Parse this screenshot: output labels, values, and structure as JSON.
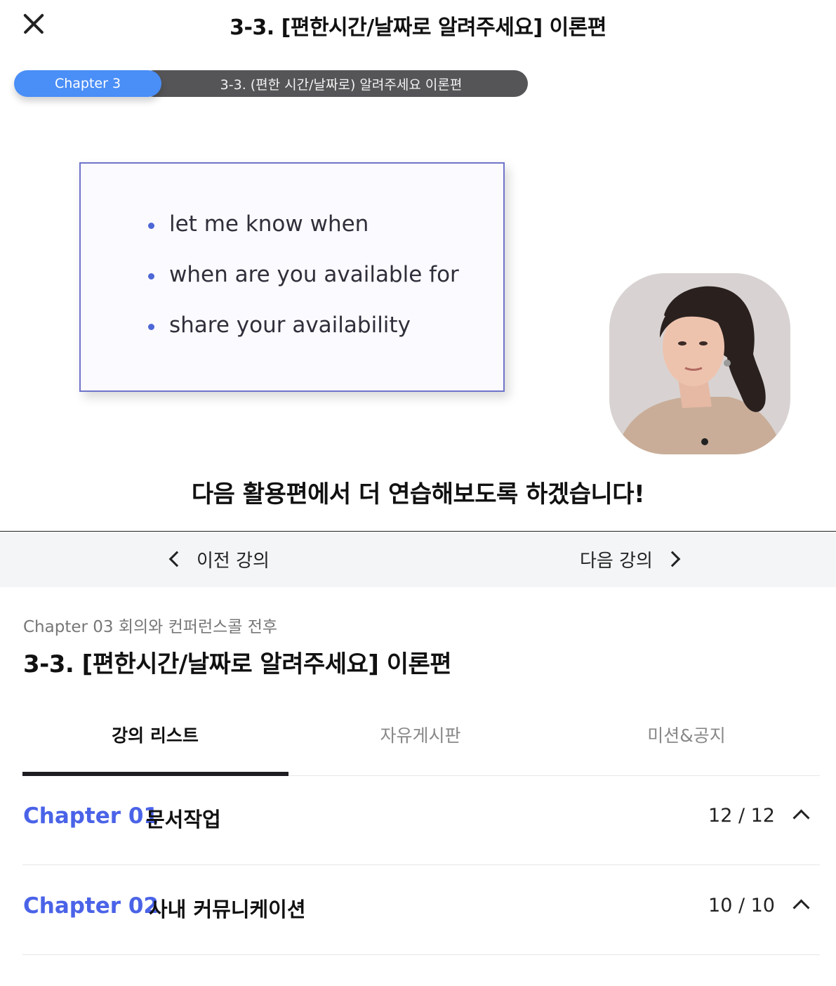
{
  "header": {
    "close_icon": "close-icon",
    "title": "3-3. [편한시간/날짜로 알려주세요] 이론편"
  },
  "video": {
    "chapter_pill": "Chapter 3",
    "lesson_pill": "3-3. (편한 시간/날짜로) 알려주세요 이론편",
    "slide_bullets": [
      "let me know when",
      "when are you available for",
      "share your availability"
    ],
    "subtitle": "다음 활용편에서 더 연습해보도록 하겠습니다!",
    "colors": {
      "pill_blue": "#4a8ef7",
      "pill_dark": "#555558",
      "bullet": "#4e67d6"
    }
  },
  "nav": {
    "prev_label": "이전 강의",
    "next_label": "다음 강의",
    "prev_icon": "chevron-left-icon",
    "next_icon": "chevron-right-icon"
  },
  "course": {
    "breadcrumb": "Chapter 03 회의와 컨퍼런스콜 전후",
    "title": "3-3. [편한시간/날짜로 알려주세요] 이론편"
  },
  "tabs": [
    {
      "label": "강의 리스트",
      "active": true
    },
    {
      "label": "자유게시판",
      "active": false
    },
    {
      "label": "미션&공지",
      "active": false
    }
  ],
  "chapters": [
    {
      "number": "Chapter 01",
      "name": "문서작업",
      "count": "12 / 12",
      "toggle_icon": "chevron-up-icon"
    },
    {
      "number": "Chapter 02",
      "name": "사내 커뮤니케이션",
      "count": "10 / 10",
      "toggle_icon": "chevron-up-icon"
    }
  ],
  "accent_color": "#4a63e8"
}
